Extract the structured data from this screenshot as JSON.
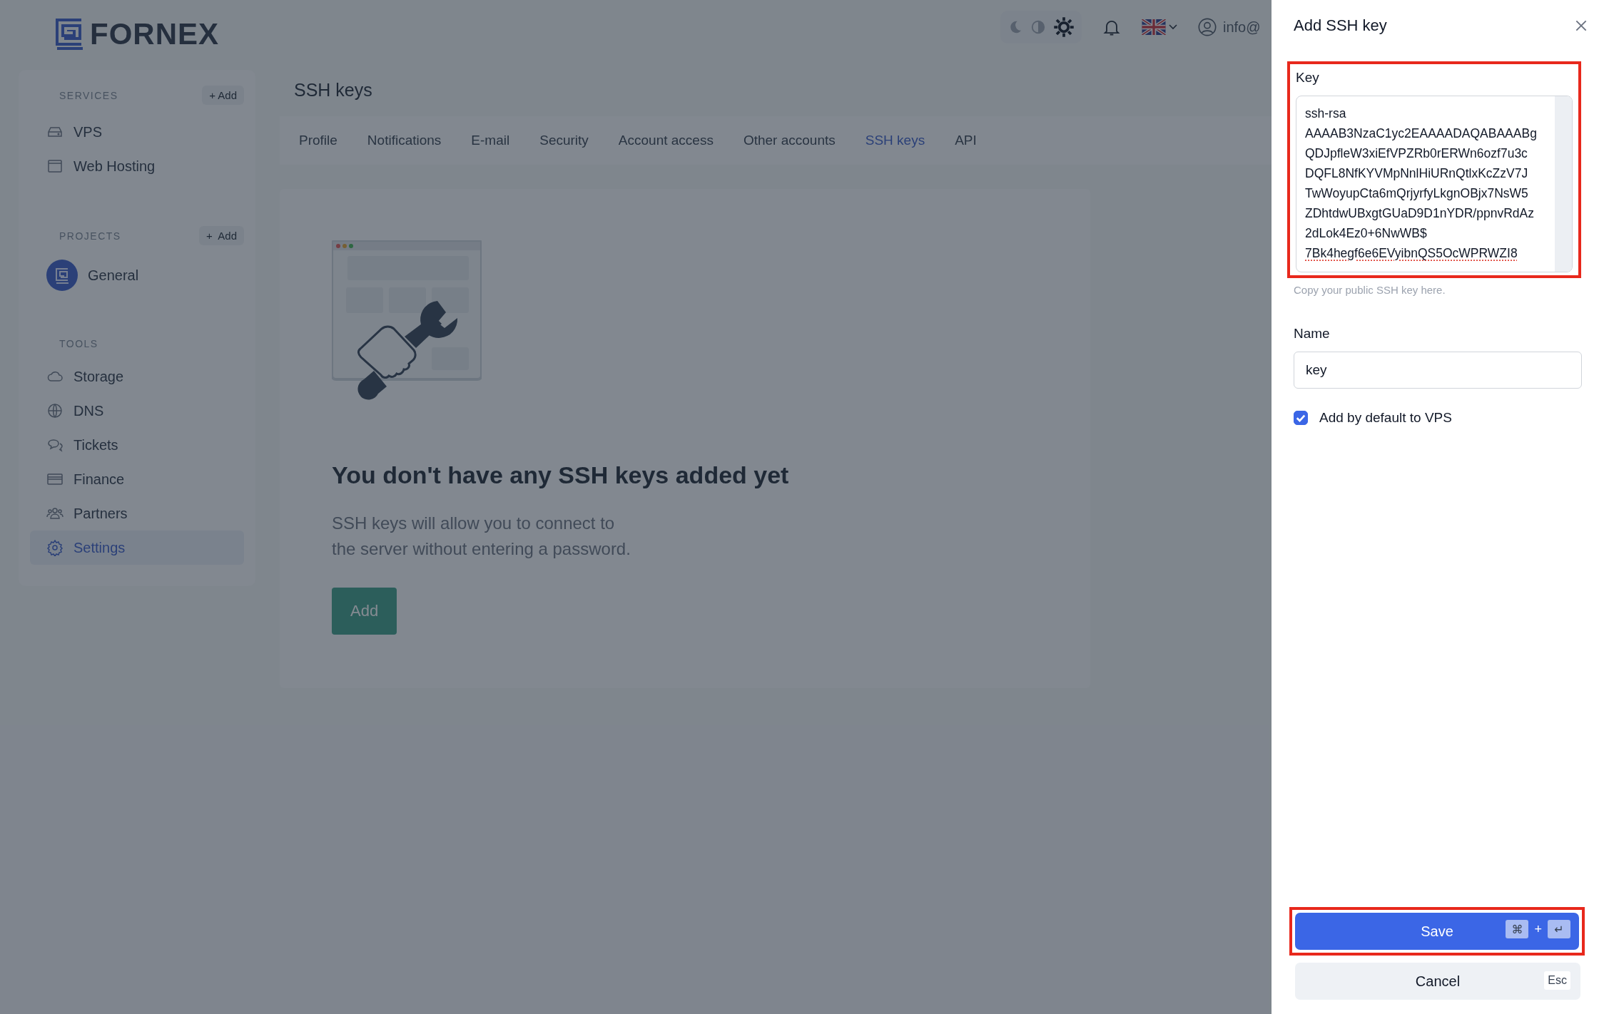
{
  "logo": {
    "text": "FORNEX"
  },
  "header": {
    "theme_options": [
      {
        "kind": "dark",
        "selected": false
      },
      {
        "kind": "auto",
        "selected": false
      },
      {
        "kind": "light",
        "selected": true
      }
    ],
    "user": "info@"
  },
  "sidebar": {
    "sections": [
      {
        "title": "SERVICES",
        "add": "+ Add",
        "items": [
          {
            "kind": "server",
            "label": "VPS",
            "selected": false
          },
          {
            "kind": "window",
            "label": "Web Hosting",
            "selected": false
          }
        ]
      },
      {
        "title": "PROJECTS",
        "add": "+  Add",
        "items": [
          {
            "kind": "project",
            "label": "General",
            "selected": false
          }
        ]
      },
      {
        "title": "TOOLS",
        "items": [
          {
            "kind": "cloud",
            "label": "Storage",
            "selected": false
          },
          {
            "kind": "globe",
            "label": "DNS",
            "selected": false
          },
          {
            "kind": "chat",
            "label": "Tickets",
            "selected": false
          },
          {
            "kind": "card",
            "label": "Finance",
            "selected": false
          },
          {
            "kind": "people",
            "label": "Partners",
            "selected": false
          },
          {
            "kind": "gear",
            "label": "Settings",
            "selected": true
          }
        ]
      }
    ]
  },
  "page": {
    "title": "SSH keys",
    "tabs": [
      {
        "label": "Profile",
        "selected": false
      },
      {
        "label": "Notifications",
        "selected": false
      },
      {
        "label": "E-mail",
        "selected": false
      },
      {
        "label": "Security",
        "selected": false
      },
      {
        "label": "Account access",
        "selected": false
      },
      {
        "label": "Other accounts",
        "selected": false
      },
      {
        "label": "SSH keys",
        "selected": true
      },
      {
        "label": "API",
        "selected": false
      }
    ],
    "empty": {
      "heading": "You don't have any SSH keys added yet",
      "text": "SSH keys will allow you to connect to\nthe server without entering a password.",
      "button": "Add"
    }
  },
  "drawer": {
    "title": "Add SSH key",
    "key": {
      "label": "Key",
      "highlighted": true,
      "value": "ssh-rsa\nAAAAB3NzaC1yc2EAAAADAQABAAABg\nQDJpfleW3xiEfVPZRb0rERWn6ozf7u3c\nDQFL8NfKYVMpNnlHiURnQtlxKcZzV7J\nTwWoyupCta6mQrjyrfyLkgnOBjx7NsW5\nZDhtdwUBxgtGUaD9D1nYDR/ppnvRdAz\n2dLok4Ez0+6NwWB$\n7Bk4hegf6e6EVyibnQS5OcWPRWZI8",
      "hint": "Copy your public SSH key here."
    },
    "name": {
      "label": "Name",
      "value": "key"
    },
    "default_vps": {
      "label": "Add by default to VPS",
      "checked": true
    },
    "save": {
      "label": "Save",
      "highlighted": true,
      "keys": [
        "⌘",
        "+",
        "↵"
      ]
    },
    "cancel": {
      "label": "Cancel",
      "key": "Esc"
    }
  }
}
